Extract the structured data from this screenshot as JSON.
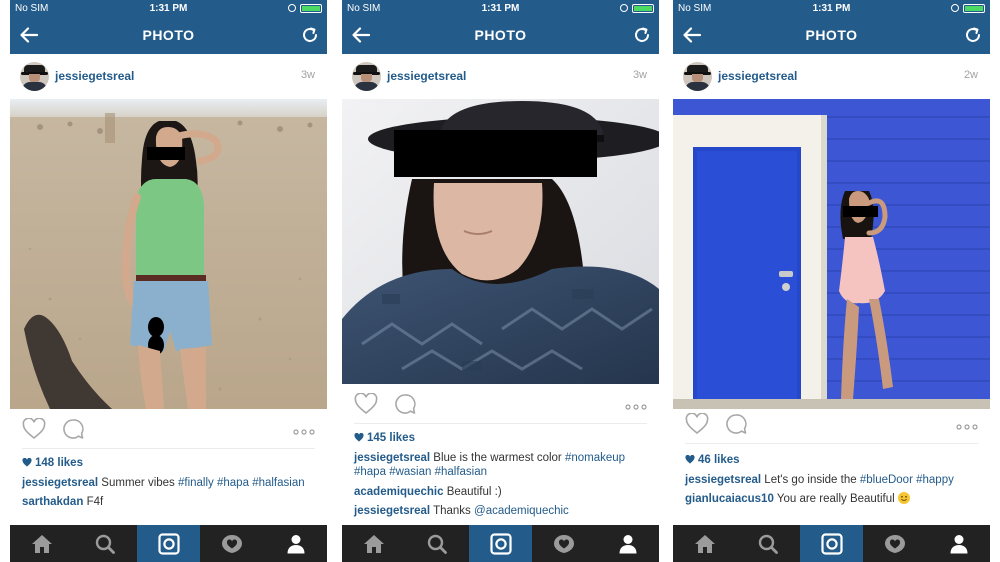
{
  "colors": {
    "nav_bar": "#235b8a",
    "tab_bar": "#222222",
    "link": "#235b8a",
    "battery": "#4cd964"
  },
  "phones": [
    {
      "status": {
        "carrier": "No SIM",
        "time": "1:31 PM"
      },
      "nav": {
        "title": "PHOTO",
        "back_icon": "back-arrow-icon",
        "refresh_icon": "refresh-icon"
      },
      "post": {
        "username": "jessiegetsreal",
        "age": "3w",
        "photo": "woman in green top on beach",
        "likes": "148 likes",
        "caption": {
          "user": "jessiegetsreal",
          "text": "Summer vibes ",
          "tags": [
            "#finally",
            "#hapa",
            "#halfasian"
          ]
        },
        "comments": [
          {
            "user": "sarthakdan",
            "text": "F4f"
          }
        ]
      }
    },
    {
      "status": {
        "carrier": "No SIM",
        "time": "1:31 PM"
      },
      "nav": {
        "title": "PHOTO",
        "back_icon": "back-arrow-icon",
        "refresh_icon": "refresh-icon"
      },
      "post": {
        "username": "jessiegetsreal",
        "age": "3w",
        "photo": "woman in black hat and blue scarf",
        "likes": "145 likes",
        "caption": {
          "user": "jessiegetsreal",
          "text": "Blue is the warmest color ",
          "tags": [
            "#nomakeup",
            "#hapa",
            "#wasian",
            "#halfasian"
          ]
        },
        "comments": [
          {
            "user": "academiquechic",
            "text": "Beautiful :)"
          },
          {
            "user": "jessiegetsreal",
            "text": "Thanks ",
            "mention": "@academiquechic"
          }
        ]
      }
    },
    {
      "status": {
        "carrier": "No SIM",
        "time": "1:31 PM"
      },
      "nav": {
        "title": "PHOTO",
        "back_icon": "back-arrow-icon",
        "refresh_icon": "refresh-icon"
      },
      "post": {
        "username": "jessiegetsreal",
        "age": "2w",
        "photo": "woman beside blue door and blue wall",
        "likes": "46 likes",
        "caption": {
          "user": "jessiegetsreal",
          "text": "Let's go inside the ",
          "tags": [
            "#blueDoor",
            "#happy"
          ]
        },
        "comments": [
          {
            "user": "gianlucaiacus10",
            "text": "You are really Beautiful ",
            "emoji": "smile-emoji"
          }
        ]
      }
    }
  ],
  "tabbar": {
    "items": [
      "home-icon",
      "search-icon",
      "camera-icon",
      "activity-icon",
      "profile-icon"
    ],
    "active_index": 2
  }
}
